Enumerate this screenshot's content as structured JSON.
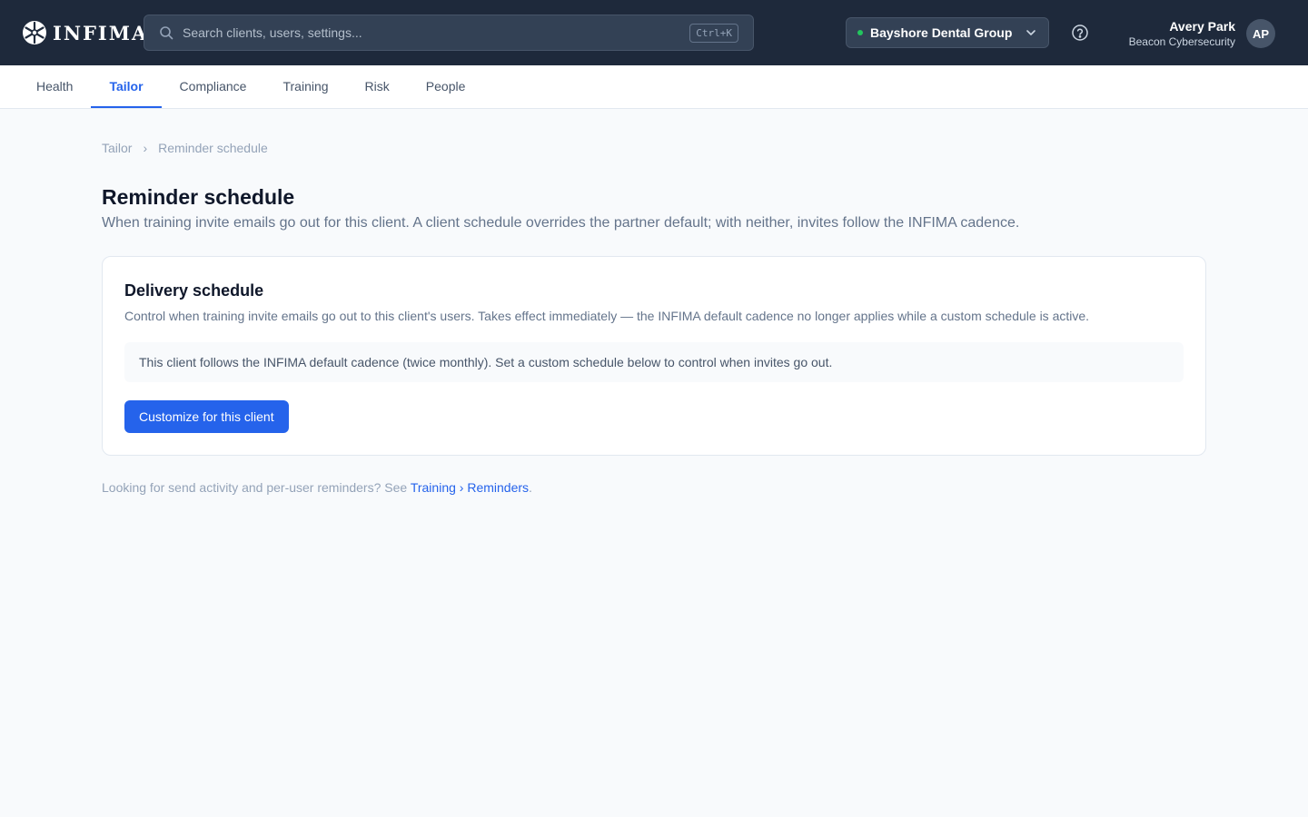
{
  "app": {
    "logo_text": "INFIMA"
  },
  "search": {
    "placeholder": "Search clients, users, settings...",
    "shortcut": "Ctrl+K"
  },
  "client_selector": {
    "name": "Bayshore Dental Group",
    "status_color": "#22c55e"
  },
  "user": {
    "name": "Avery Park",
    "org": "Beacon Cybersecurity",
    "initials": "AP"
  },
  "tabs": [
    {
      "label": "Health",
      "active": false
    },
    {
      "label": "Tailor",
      "active": true
    },
    {
      "label": "Compliance",
      "active": false
    },
    {
      "label": "Training",
      "active": false
    },
    {
      "label": "Risk",
      "active": false
    },
    {
      "label": "People",
      "active": false
    }
  ],
  "breadcrumb": {
    "parent": "Tailor",
    "separator": "›",
    "current": "Reminder schedule"
  },
  "page": {
    "title": "Reminder schedule",
    "subtitle": "When training invite emails go out for this client. A client schedule overrides the partner default; with neither, invites follow the INFIMA cadence."
  },
  "card": {
    "title": "Delivery schedule",
    "description": "Control when training invite emails go out to this client's users. Takes effect immediately — the INFIMA default cadence no longer applies while a custom schedule is active.",
    "notice": "This client follows the INFIMA default cadence (twice monthly). Set a custom schedule below to control when invites go out.",
    "button_label": "Customize for this client"
  },
  "footer": {
    "prefix": "Looking for send activity and per-user reminders? See ",
    "link_label": "Training › Reminders",
    "suffix": "."
  },
  "colors": {
    "topbar": "#1e293b",
    "accent": "#2563eb",
    "background": "#f8fafc"
  },
  "icons": {
    "logo": "snowflake-logo-icon",
    "search": "search-icon",
    "dropdown": "chevron-down-icon",
    "help": "help-circle-icon"
  }
}
